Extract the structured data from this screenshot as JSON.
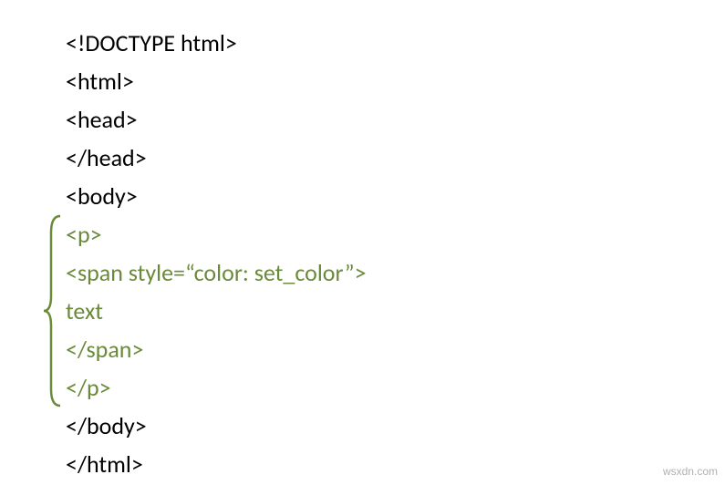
{
  "code": {
    "line1": "<!DOCTYPE html>",
    "line2": "<html>",
    "line3": "<head>",
    "line4": "</head>",
    "line5": "<body>",
    "line6": "<p>",
    "line7": "<span style=“color: set_color”>",
    "line8": "text",
    "line9": "</span>",
    "line10": "</p>",
    "line11": "</body>",
    "line12": "</html>"
  },
  "watermark": "wsxdn.com",
  "colors": {
    "highlight": "#6a8a3a",
    "normal": "#000000"
  }
}
